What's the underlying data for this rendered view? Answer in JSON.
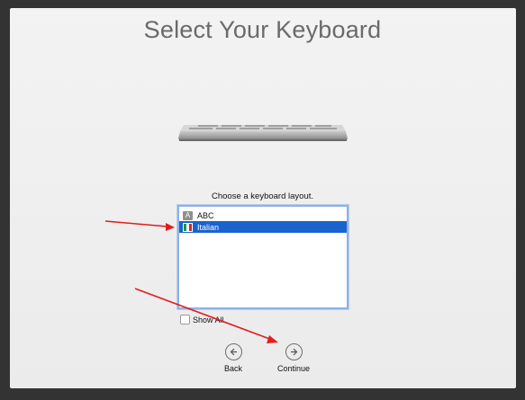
{
  "window": {
    "title": "Select Your Keyboard"
  },
  "layout_picker": {
    "prompt": "Choose a keyboard layout.",
    "items": [
      {
        "label": "ABC",
        "icon": "abc-icon",
        "selected": false
      },
      {
        "label": "Italian",
        "icon": "italian-flag-icon",
        "selected": true
      }
    ],
    "show_all_label": "Show All",
    "show_all_checked": false
  },
  "navigation": {
    "back_label": "Back",
    "continue_label": "Continue"
  },
  "icons": {
    "abc_glyph": "A"
  },
  "colors": {
    "selection": "#1a63cf",
    "focus_ring": "#8db2e8",
    "annotation_arrow": "#e31c1c",
    "flag_green": "#159846",
    "flag_white": "#ffffff",
    "flag_red": "#cf2734"
  }
}
